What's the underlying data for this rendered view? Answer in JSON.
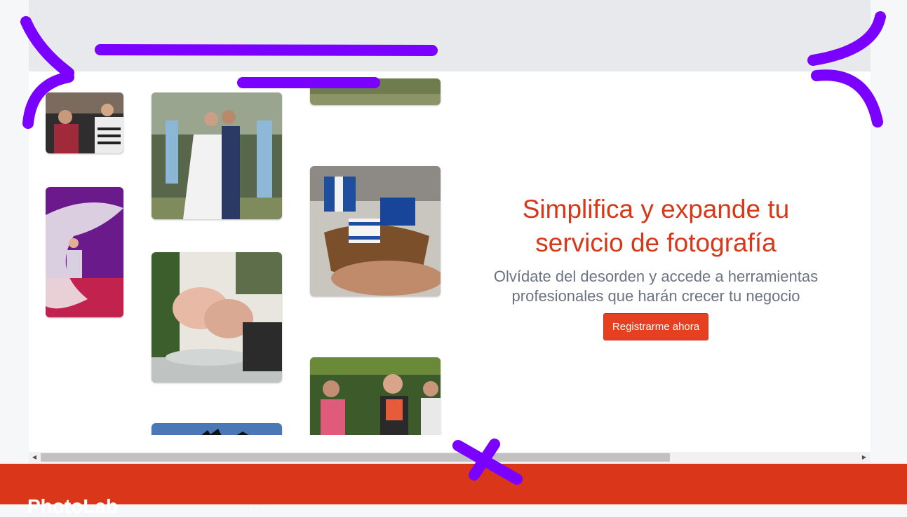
{
  "hero": {
    "title_line1": "Simplifica y expande tu",
    "title_line2": "servicio de fotografía",
    "subtitle_line1": "Olvídate del desorden y accede a herramientas",
    "subtitle_line2": "profesionales que harán crecer tu negocio",
    "cta_label": "Registrarme ahora"
  },
  "footer": {
    "brand": "PhotoLab",
    "menu_dots": "···"
  },
  "colors": {
    "accent": "#d6381a",
    "button": "#e5401f",
    "footer": "#d9361a",
    "annotation": "#7a00ff"
  },
  "gallery": {
    "photos": [
      "festival-crowd-photo",
      "wedding-couple-photo",
      "grass-field-photo",
      "dancer-silk-photo",
      "israel-gifts-photo",
      "baptism-photo",
      "runners-photo",
      "sky-photo"
    ]
  }
}
